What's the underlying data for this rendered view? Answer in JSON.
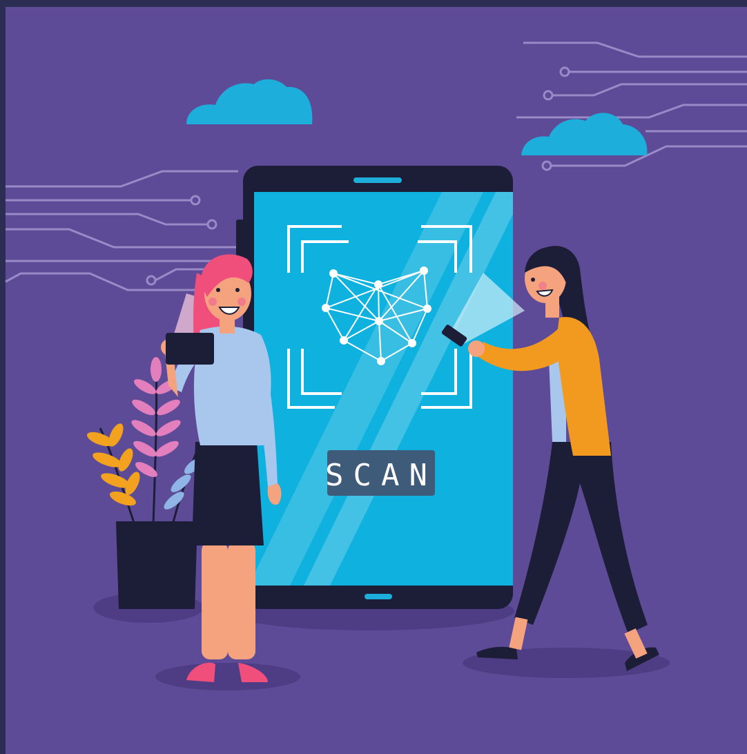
{
  "illustration": {
    "scan_label": "SCAN"
  },
  "colors": {
    "frame": "#2b2d52",
    "background": "#5e4b98",
    "screen": "#0fb1de",
    "device": "#1c1d36",
    "cloud": "#1daedc",
    "circuit": "#9b8ac8",
    "shirt_blue": "#a9c6ec",
    "sweater_orange": "#f29a1f",
    "hair_pink": "#ef4f7a",
    "skin": "#f5a27f",
    "plant_pink": "#e37fbd",
    "plant_orange": "#f2a21f",
    "plant_blue": "#8fb4e6"
  },
  "icons": [
    "face-scan-icon",
    "cloud-icon",
    "circuit-line-icon",
    "plant-icon",
    "phone-icon"
  ]
}
